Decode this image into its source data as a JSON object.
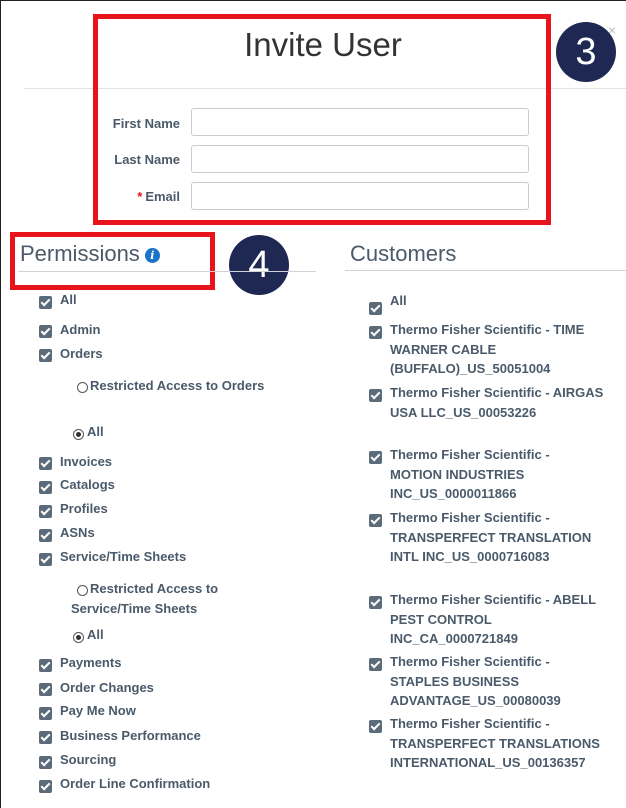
{
  "dialog": {
    "title": "Invite User",
    "close_glyph": "×"
  },
  "form": {
    "first_name_label": "First Name",
    "last_name_label": "Last Name",
    "email_label": "Email",
    "required_mark": "*",
    "first_name_value": "",
    "last_name_value": "",
    "email_value": ""
  },
  "callouts": [
    "3",
    "4"
  ],
  "permissions": {
    "title": "Permissions",
    "info_glyph": "i",
    "items": [
      {
        "label": "All",
        "checked": true
      },
      {
        "label": "Admin",
        "checked": true
      },
      {
        "label": "Orders",
        "checked": true
      },
      {
        "label": "Restricted Access to Orders",
        "selected": false
      },
      {
        "label": "All",
        "selected": true
      },
      {
        "label": "Invoices",
        "checked": true
      },
      {
        "label": "Catalogs",
        "checked": true
      },
      {
        "label": "Profiles",
        "checked": true
      },
      {
        "label": "ASNs",
        "checked": true
      },
      {
        "label": "Service/Time Sheets",
        "checked": true
      },
      {
        "label": "Restricted Access to Service/Time Sheets",
        "selected": false
      },
      {
        "label": "All",
        "selected": true
      },
      {
        "label": "Payments",
        "checked": true
      },
      {
        "label": "Order Changes",
        "checked": true
      },
      {
        "label": "Pay Me Now",
        "checked": true
      },
      {
        "label": "Business Performance",
        "checked": true
      },
      {
        "label": "Sourcing",
        "checked": true
      },
      {
        "label": "Order Line Confirmation",
        "checked": true
      }
    ]
  },
  "customers": {
    "title": "Customers",
    "items": [
      {
        "label": "All",
        "checked": true
      },
      {
        "label": "Thermo Fisher Scientific - TIME WARNER CABLE (BUFFALO)_US_50051004",
        "checked": true
      },
      {
        "label": "Thermo Fisher Scientific - AIRGAS USA LLC_US_00053226",
        "checked": true
      },
      {
        "label": "Thermo Fisher Scientific - MOTION INDUSTRIES INC_US_0000011866",
        "checked": true
      },
      {
        "label": "Thermo Fisher Scientific - TRANSPERFECT TRANSLATION INTL INC_US_0000716083",
        "checked": true
      },
      {
        "label": "Thermo Fisher Scientific - ABELL PEST CONTROL INC_CA_0000721849",
        "checked": true
      },
      {
        "label": "Thermo Fisher Scientific - STAPLES BUSINESS ADVANTAGE_US_00080039",
        "checked": true
      },
      {
        "label": "Thermo Fisher Scientific - TRANSPERFECT TRANSLATIONS INTERNATIONAL_US_00136357",
        "checked": true
      }
    ]
  },
  "colors": {
    "callout_border": "#e8131b",
    "badge_fill": "#1f2852",
    "checkbox": "#5b6b79",
    "info_icon": "#1a73c8"
  }
}
